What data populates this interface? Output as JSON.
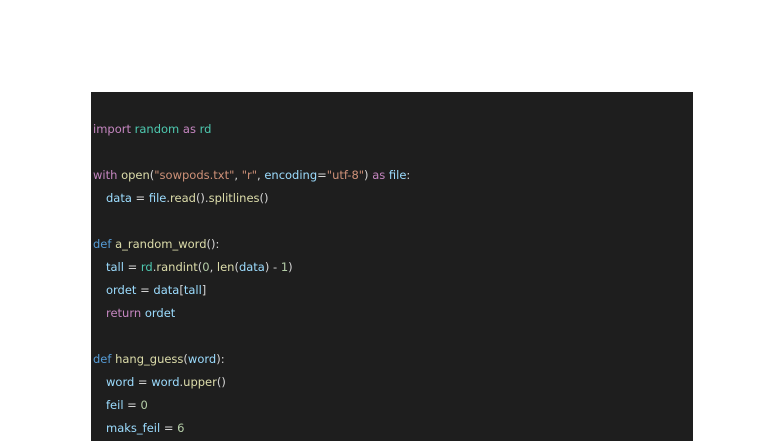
{
  "editor": {
    "lines": {
      "l1": {
        "t1": "import",
        "t2": " ",
        "t3": "random",
        "t4": " ",
        "t5": "as",
        "t6": " ",
        "t7": "rd"
      },
      "l3": {
        "t1": "with",
        "t2": " ",
        "t3": "open",
        "t4": "(",
        "t5": "\"sowpods.txt\"",
        "t6": ", ",
        "t7": "\"r\"",
        "t8": ", ",
        "t9": "encoding",
        "t10": "=",
        "t11": "\"utf-8\"",
        "t12": ") ",
        "t13": "as",
        "t14": " ",
        "t15": "file",
        "t16": ":"
      },
      "l4": {
        "t1": "data",
        "t2": " = ",
        "t3": "file",
        "t4": ".",
        "t5": "read",
        "t6": "().",
        "t7": "splitlines",
        "t8": "()"
      },
      "l6": {
        "t1": "def",
        "t2": " ",
        "t3": "a_random_word",
        "t4": "():"
      },
      "l7": {
        "t1": "tall",
        "t2": " = ",
        "t3": "rd",
        "t4": ".",
        "t5": "randint",
        "t6": "(",
        "t7": "0",
        "t8": ", ",
        "t9": "len",
        "t10": "(",
        "t11": "data",
        "t12": ") - ",
        "t13": "1",
        "t14": ")"
      },
      "l8": {
        "t1": "ordet",
        "t2": " = ",
        "t3": "data",
        "t4": "[",
        "t5": "tall",
        "t6": "]"
      },
      "l9": {
        "t1": "return",
        "t2": " ",
        "t3": "ordet"
      },
      "l11": {
        "t1": "def",
        "t2": " ",
        "t3": "hang_guess",
        "t4": "(",
        "t5": "word",
        "t6": "):"
      },
      "l12": {
        "t1": "word",
        "t2": " = ",
        "t3": "word",
        "t4": ".",
        "t5": "upper",
        "t6": "()"
      },
      "l13": {
        "t1": "feil",
        "t2": " = ",
        "t3": "0"
      },
      "l14": {
        "t1": "maks_feil",
        "t2": " = ",
        "t3": "6"
      }
    }
  }
}
